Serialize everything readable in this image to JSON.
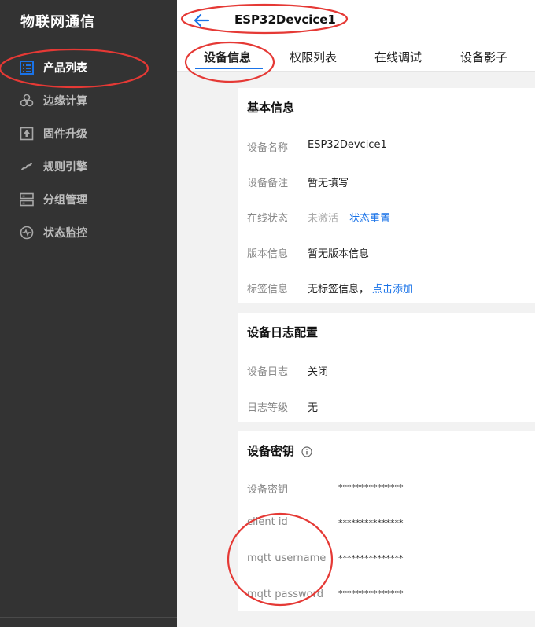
{
  "sidebar": {
    "brand": "物联网通信",
    "items": [
      {
        "label": "产品列表",
        "icon": "product-list-icon",
        "active": true
      },
      {
        "label": "边缘计算",
        "icon": "edge-compute-icon",
        "active": false
      },
      {
        "label": "固件升级",
        "icon": "firmware-upgrade-icon",
        "active": false
      },
      {
        "label": "规则引擎",
        "icon": "rule-engine-icon",
        "active": false
      },
      {
        "label": "分组管理",
        "icon": "group-manage-icon",
        "active": false
      },
      {
        "label": "状态监控",
        "icon": "status-monitor-icon",
        "active": false
      }
    ]
  },
  "header": {
    "title": "ESP32Devcice1",
    "back_icon": "arrow-left-icon",
    "tabs": [
      {
        "label": "设备信息",
        "active": true
      },
      {
        "label": "权限列表",
        "active": false
      },
      {
        "label": "在线调试",
        "active": false
      },
      {
        "label": "设备影子",
        "active": false
      }
    ]
  },
  "basic_info": {
    "title": "基本信息",
    "device_name_label": "设备名称",
    "device_name": "ESP32Devcice1",
    "remark_label": "设备备注",
    "remark": "暂无填写",
    "online_label": "在线状态",
    "online_status": "未激活",
    "online_reset": "状态重置",
    "version_label": "版本信息",
    "version": "暂无版本信息",
    "tag_label": "标签信息",
    "tag": "无标签信息，",
    "tag_add": "点击添加"
  },
  "log_config": {
    "title": "设备日志配置",
    "log_label": "设备日志",
    "log_value": "关闭",
    "level_label": "日志等级",
    "level_value": "无"
  },
  "device_secret": {
    "title": "设备密钥",
    "info_icon": "info-icon",
    "rows": [
      {
        "label": "设备密钥",
        "value": "***************"
      },
      {
        "label": "client id",
        "value": "***************"
      },
      {
        "label": "mqtt username",
        "value": "***************"
      },
      {
        "label": "mqtt password",
        "value": "***************"
      }
    ]
  },
  "colors": {
    "sidebar_bg": "#333333",
    "accent": "#1a73e8",
    "annotation": "#e53935",
    "page_bg": "#f2f2f2"
  }
}
